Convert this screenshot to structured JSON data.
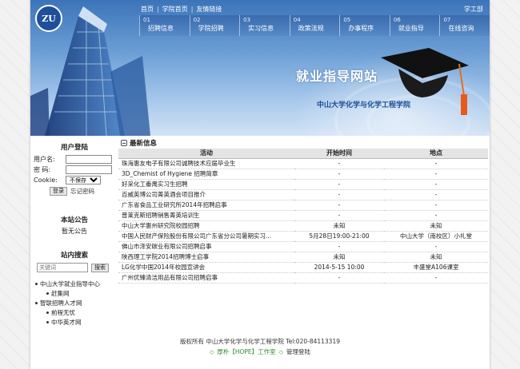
{
  "header": {
    "logo_text": "ZU",
    "top_links": [
      "首页",
      "学院首页",
      "友情链接"
    ],
    "right_link": "学工部",
    "nav": [
      {
        "num": "01",
        "label": "招聘信息"
      },
      {
        "num": "02",
        "label": "学院招聘"
      },
      {
        "num": "03",
        "label": "实习信息"
      },
      {
        "num": "04",
        "label": "政策法规"
      },
      {
        "num": "05",
        "label": "办事程序"
      },
      {
        "num": "06",
        "label": "就业指导"
      },
      {
        "num": "07",
        "label": "在线咨询"
      }
    ],
    "banner_title": "就业指导网站",
    "banner_subtitle": "中山大学化学与化学工程学院"
  },
  "sidebar": {
    "login_title": "用户登陆",
    "username_label": "用户名:",
    "password_label": "密  码:",
    "cookie_label": "Cookie:",
    "cookie_value": "不保存",
    "login_button": "登录",
    "forgot_link": "忘记密码",
    "notice_title": "本站公告",
    "notice_text": "暂无公告",
    "search_title": "站内搜索",
    "search_placeholder": "关键词",
    "search_button": "搜索",
    "links": [
      {
        "text": "中山大学就业指导中心",
        "level": 1
      },
      {
        "text": "赶集网",
        "level": 2
      },
      {
        "text": "智联招聘人才网",
        "level": 1
      },
      {
        "text": "前程无忧",
        "level": 2
      },
      {
        "text": "中华英才网",
        "level": 2
      }
    ]
  },
  "main": {
    "section_title": "最新信息",
    "columns": [
      "活动",
      "开始时间",
      "地点"
    ],
    "rows": [
      [
        "珠海惠友电子有限公司诚聘技术应届毕业生",
        "-",
        "-"
      ],
      [
        "3D_Chemist of Hygiene 招聘简章",
        "-",
        "-"
      ],
      [
        "好采化工番禺实习生招聘",
        "-",
        "-"
      ],
      [
        "百威英博公司菁英酒会项目推介",
        "-",
        "-"
      ],
      [
        "广东省食品工业研究所2014年招聘启事",
        "-",
        "-"
      ],
      [
        "普莱克斯招聘销售菁英培训生",
        "-",
        "-"
      ],
      [
        "中山大学惠州研究院校园招聘",
        "未知",
        "未知"
      ],
      [
        "中国人民财产保险股份有限公司广东省分公司暑期实习...",
        "5月28日19:00-21:00",
        "中山大学（南校区）小礼堂"
      ],
      [
        "佛山市泽安碳业有限公司招聘启事",
        "-",
        "-"
      ],
      [
        "陕西理工学院2014招聘博士启事",
        "未知",
        "未知"
      ],
      [
        "LG化学中国2014年校园宣讲会",
        "2014-5-15 10:00",
        "丰盛堂A106课室"
      ],
      [
        "广州优臻清洁用品有限公司招聘启事",
        "-",
        "-"
      ]
    ]
  },
  "footer": {
    "copyright": "版权所有 中山大学化学与化学工程学院 Tel:020-84113319",
    "link1": "厚朴【HOPE】工作室",
    "link2": "管理登陆"
  }
}
